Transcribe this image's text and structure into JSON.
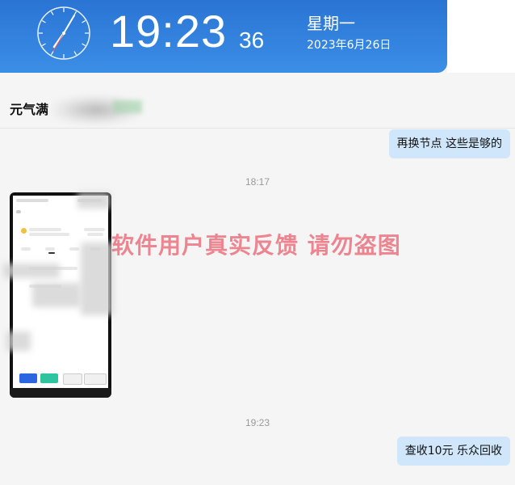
{
  "clock": {
    "time": "19:23",
    "seconds": "36",
    "weekday": "星期一",
    "date": "2023年6月26日"
  },
  "chat": {
    "contact_name": "元气满",
    "messages": [
      {
        "type": "text",
        "side": "right",
        "text": "再换节点   这些是够的"
      },
      {
        "type": "timestamp",
        "text": "18:17"
      },
      {
        "type": "image",
        "side": "left",
        "description": "phone-screenshot"
      },
      {
        "type": "timestamp",
        "text": "19:23"
      },
      {
        "type": "text",
        "side": "right",
        "text": "查收10元   乐众回收"
      }
    ]
  },
  "watermark": "软件用户真实反馈  请勿盗图",
  "colors": {
    "banner": "#2a74d4",
    "bubble": "#cfe6fb",
    "watermark": "#e85f6e",
    "background": "#f5f5f5"
  }
}
